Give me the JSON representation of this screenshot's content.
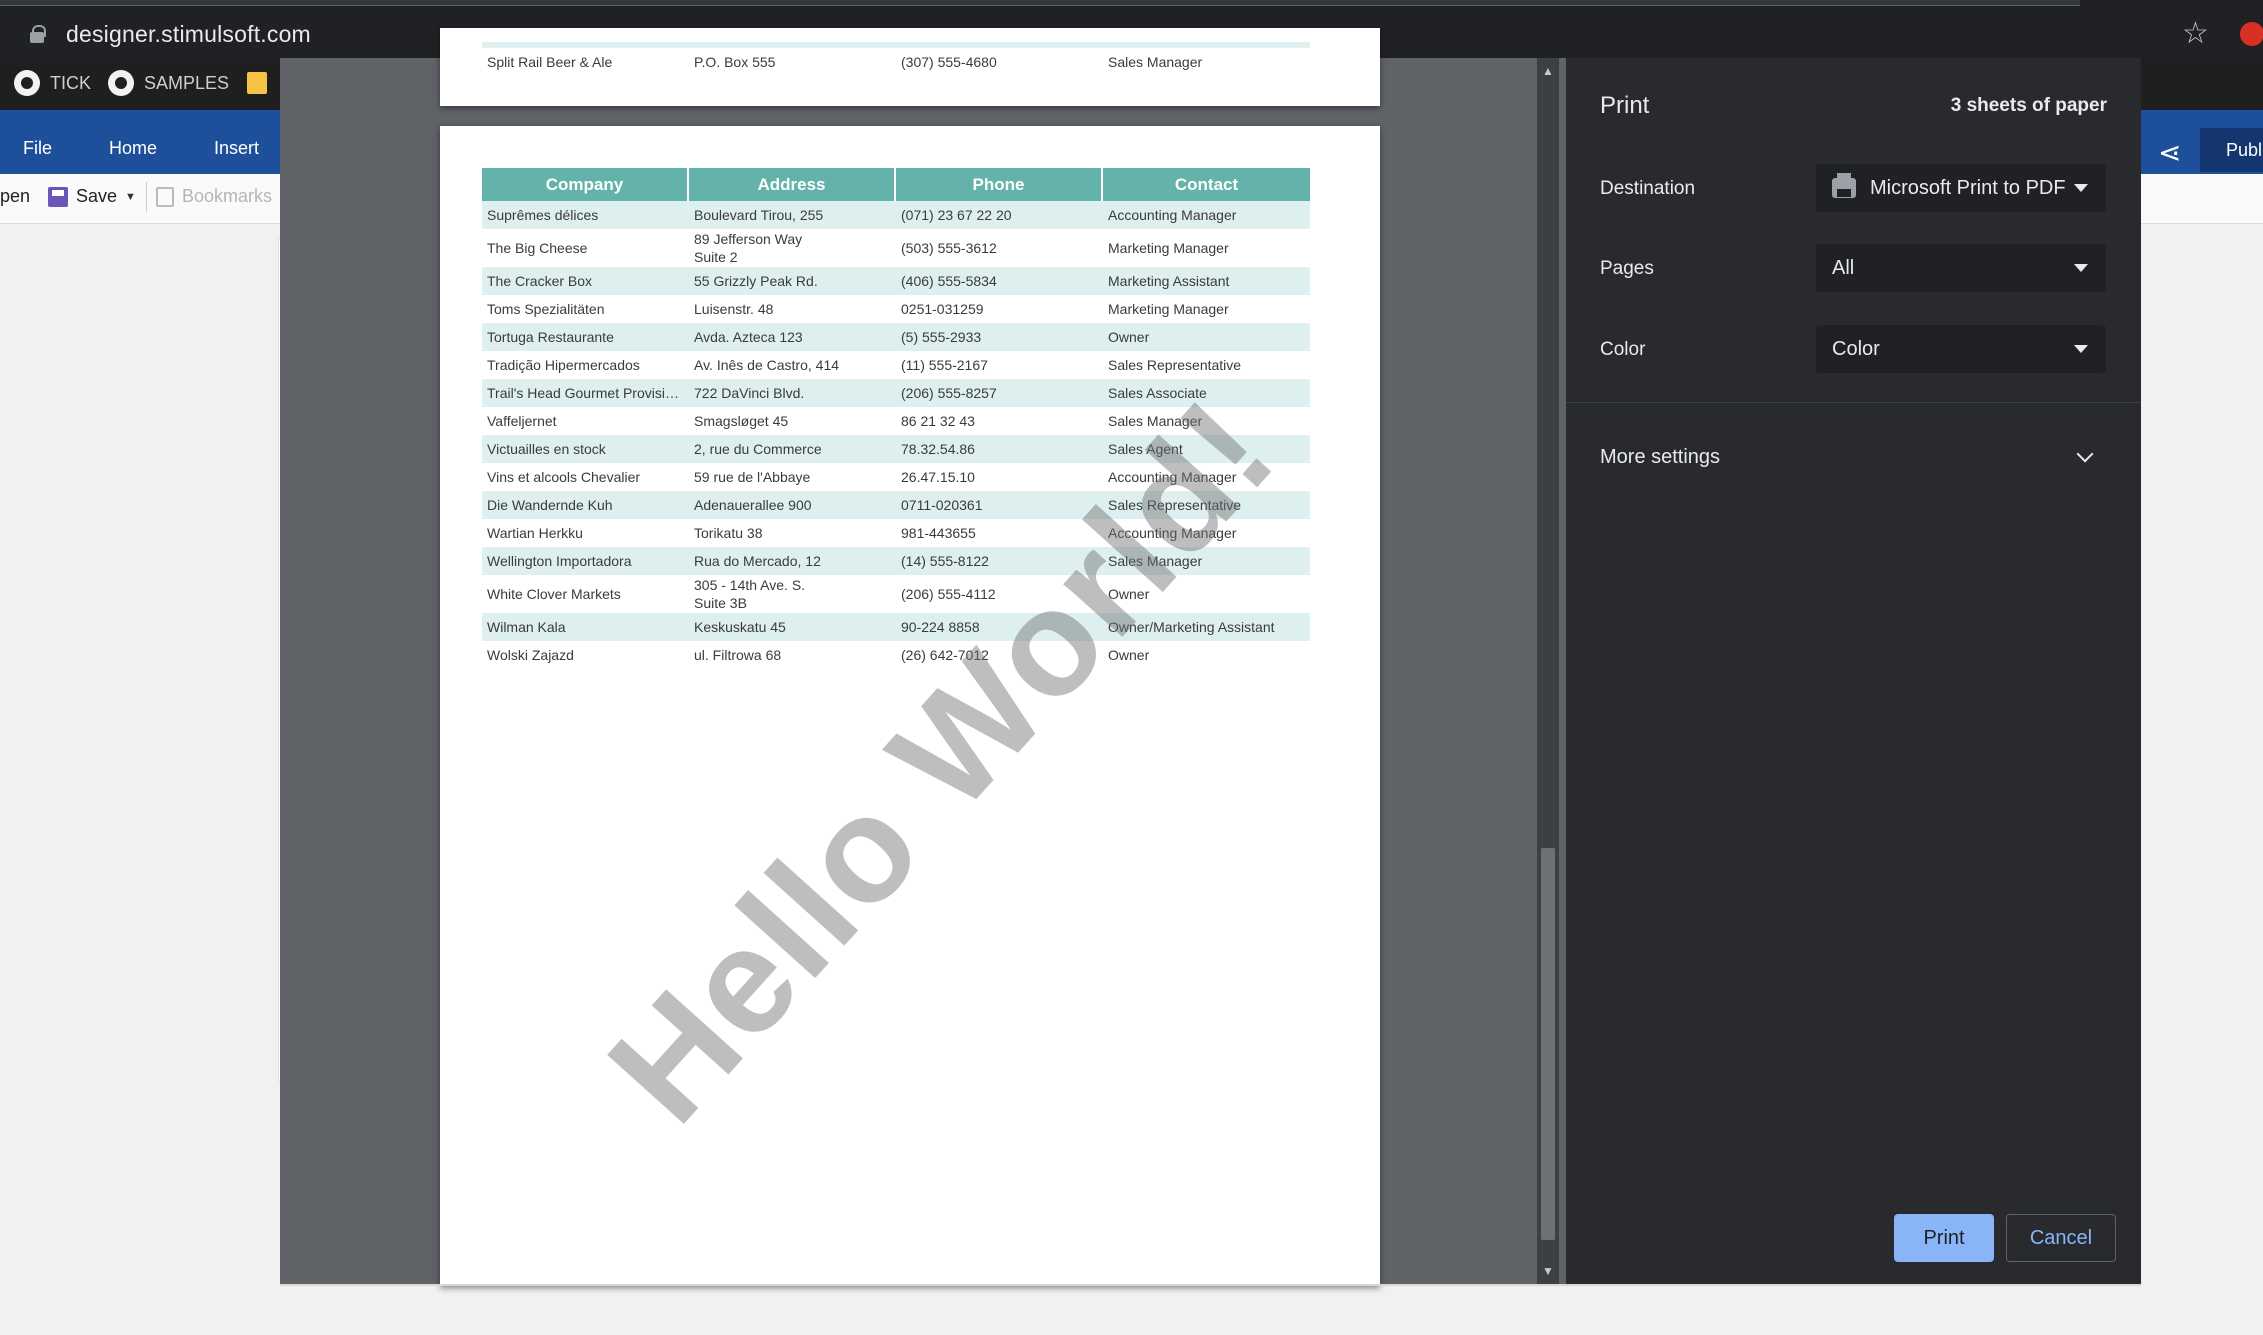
{
  "browser": {
    "url": "designer.stimulsoft.com",
    "icons": {
      "lock": "lock-icon",
      "star": "star-icon",
      "extension": "extension-icon"
    }
  },
  "bookmarks": [
    {
      "label": "TICK",
      "icon": "github-icon"
    },
    {
      "label": "SAMPLES",
      "icon": "github-icon"
    }
  ],
  "app": {
    "tabs": [
      "File",
      "Home",
      "Insert"
    ],
    "publish_label": "Publi",
    "toolbar": {
      "open_label": "pen",
      "save_label": "Save",
      "bookmarks_label": "Bookmarks"
    }
  },
  "preview": {
    "previous_page_row": {
      "company": "Split Rail Beer & Ale",
      "address": "P.O. Box 555",
      "phone": "(307) 555-4680",
      "contact": "Sales Manager"
    },
    "watermark": "Hello World!",
    "table": {
      "headers": [
        "Company",
        "Address",
        "Phone",
        "Contact"
      ],
      "rows": [
        {
          "company": "Suprêmes délices",
          "address": "Boulevard Tirou, 255",
          "address2": "",
          "phone": "(071) 23 67 22 20",
          "contact": "Accounting Manager"
        },
        {
          "company": "The Big Cheese",
          "address": "89 Jefferson Way",
          "address2": "Suite 2",
          "phone": "(503) 555-3612",
          "contact": "Marketing Manager"
        },
        {
          "company": "The Cracker Box",
          "address": "55 Grizzly Peak Rd.",
          "address2": "",
          "phone": "(406) 555-5834",
          "contact": "Marketing Assistant"
        },
        {
          "company": "Toms Spezialitäten",
          "address": "Luisenstr. 48",
          "address2": "",
          "phone": "0251-031259",
          "contact": "Marketing Manager"
        },
        {
          "company": "Tortuga Restaurante",
          "address": "Avda. Azteca 123",
          "address2": "",
          "phone": "(5) 555-2933",
          "contact": "Owner"
        },
        {
          "company": "Tradição Hipermercados",
          "address": "Av. Inês de Castro, 414",
          "address2": "",
          "phone": "(11) 555-2167",
          "contact": "Sales Representative"
        },
        {
          "company": "Trail's Head Gourmet Provisio...",
          "address": "722 DaVinci Blvd.",
          "address2": "",
          "phone": "(206) 555-8257",
          "contact": "Sales Associate"
        },
        {
          "company": "Vaffeljernet",
          "address": "Smagsløget 45",
          "address2": "",
          "phone": "86 21 32 43",
          "contact": "Sales Manager"
        },
        {
          "company": "Victuailles en stock",
          "address": "2, rue du Commerce",
          "address2": "",
          "phone": "78.32.54.86",
          "contact": "Sales Agent"
        },
        {
          "company": "Vins et alcools Chevalier",
          "address": "59 rue de l'Abbaye",
          "address2": "",
          "phone": "26.47.15.10",
          "contact": "Accounting Manager"
        },
        {
          "company": "Die Wandernde Kuh",
          "address": "Adenauerallee 900",
          "address2": "",
          "phone": "0711-020361",
          "contact": "Sales Representative"
        },
        {
          "company": "Wartian Herkku",
          "address": "Torikatu 38",
          "address2": "",
          "phone": "981-443655",
          "contact": "Accounting Manager"
        },
        {
          "company": "Wellington Importadora",
          "address": "Rua do Mercado, 12",
          "address2": "",
          "phone": "(14) 555-8122",
          "contact": "Sales Manager"
        },
        {
          "company": "White Clover Markets",
          "address": "305 - 14th Ave. S.",
          "address2": "Suite 3B",
          "phone": "(206) 555-4112",
          "contact": "Owner"
        },
        {
          "company": "Wilman Kala",
          "address": "Keskuskatu 45",
          "address2": "",
          "phone": "90-224 8858",
          "contact": "Owner/Marketing Assistant"
        },
        {
          "company": "Wolski  Zajazd",
          "address": "ul. Filtrowa 68",
          "address2": "",
          "phone": "(26) 642-7012",
          "contact": "Owner"
        }
      ]
    }
  },
  "print_dialog": {
    "title": "Print",
    "sheets": "3 sheets of paper",
    "destination": {
      "label": "Destination",
      "value": "Microsoft Print to PDF"
    },
    "pages": {
      "label": "Pages",
      "value": "All"
    },
    "color": {
      "label": "Color",
      "value": "Color"
    },
    "more_settings": "More settings",
    "print_button": "Print",
    "cancel_button": "Cancel"
  },
  "colors": {
    "header_teal": "#63b3aa",
    "row_alt": "#ddefee",
    "dialog_bg": "#292a2d",
    "accent_blue": "#8ab4f8",
    "ribbon_blue": "#1e4f9b"
  }
}
